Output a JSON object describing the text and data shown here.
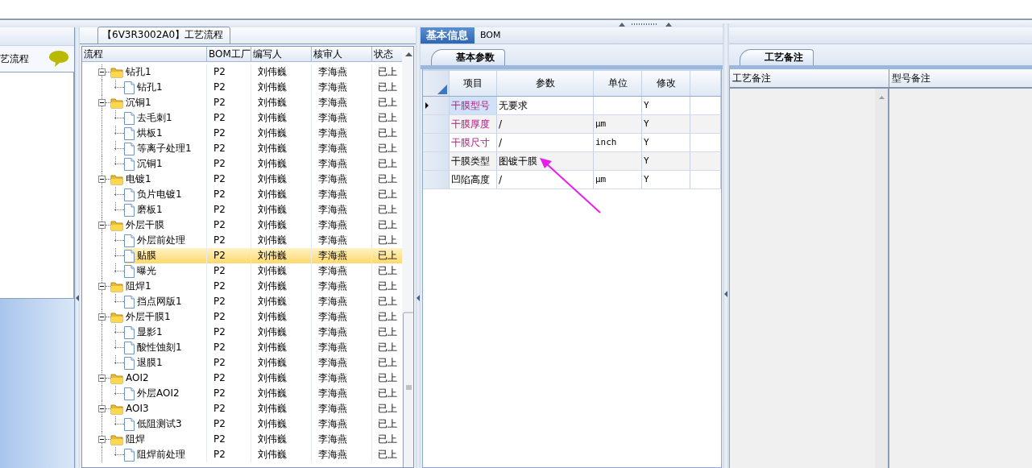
{
  "left_panel": {
    "title": "艺流程"
  },
  "process_tab": {
    "title": "【6V3R3002A0】工艺流程"
  },
  "process_table": {
    "columns": [
      "流程",
      "BOM工厂",
      "编写人",
      "核审人",
      "状态"
    ],
    "rows": [
      {
        "kind": "folder",
        "label": "钻孔1",
        "expanded": true,
        "selected": false,
        "bom": "P2",
        "author": "刘伟巍",
        "reviewer": "李海燕",
        "status": "已上",
        "children": [
          {
            "kind": "file",
            "label": "钻孔1",
            "selected": false,
            "bom": "P2",
            "author": "刘伟巍",
            "reviewer": "李海燕",
            "status": "已上"
          }
        ]
      },
      {
        "kind": "folder",
        "label": "沉铜1",
        "expanded": true,
        "selected": false,
        "bom": "P2",
        "author": "刘伟巍",
        "reviewer": "李海燕",
        "status": "已上",
        "children": [
          {
            "kind": "file",
            "label": "去毛刺1",
            "selected": false,
            "bom": "P2",
            "author": "刘伟巍",
            "reviewer": "李海燕",
            "status": "已上"
          },
          {
            "kind": "file",
            "label": "烘板1",
            "selected": false,
            "bom": "P2",
            "author": "刘伟巍",
            "reviewer": "李海燕",
            "status": "已上"
          },
          {
            "kind": "file",
            "label": "等离子处理1",
            "selected": false,
            "bom": "P2",
            "author": "刘伟巍",
            "reviewer": "李海燕",
            "status": "已上"
          },
          {
            "kind": "file",
            "label": "沉铜1",
            "selected": false,
            "bom": "P2",
            "author": "刘伟巍",
            "reviewer": "李海燕",
            "status": "已上"
          }
        ]
      },
      {
        "kind": "folder",
        "label": "电镀1",
        "expanded": true,
        "selected": false,
        "bom": "P2",
        "author": "刘伟巍",
        "reviewer": "李海燕",
        "status": "已上",
        "children": [
          {
            "kind": "file",
            "label": "负片电镀1",
            "selected": false,
            "bom": "P2",
            "author": "刘伟巍",
            "reviewer": "李海燕",
            "status": "已上"
          },
          {
            "kind": "file",
            "label": "磨板1",
            "selected": false,
            "bom": "P2",
            "author": "刘伟巍",
            "reviewer": "李海燕",
            "status": "已上"
          }
        ]
      },
      {
        "kind": "folder",
        "label": "外层干膜",
        "expanded": true,
        "selected": false,
        "bom": "P2",
        "author": "刘伟巍",
        "reviewer": "李海燕",
        "status": "已上",
        "children": [
          {
            "kind": "file",
            "label": "外层前处理",
            "selected": false,
            "bom": "P2",
            "author": "刘伟巍",
            "reviewer": "李海燕",
            "status": "已上"
          },
          {
            "kind": "file",
            "label": "贴膜",
            "selected": true,
            "bom": "P2",
            "author": "刘伟巍",
            "reviewer": "李海燕",
            "status": "已上"
          },
          {
            "kind": "file",
            "label": "曝光",
            "selected": false,
            "bom": "P2",
            "author": "刘伟巍",
            "reviewer": "李海燕",
            "status": "已上"
          }
        ]
      },
      {
        "kind": "folder",
        "label": "阻焊1",
        "expanded": true,
        "selected": false,
        "bom": "P2",
        "author": "刘伟巍",
        "reviewer": "李海燕",
        "status": "已上",
        "children": [
          {
            "kind": "file",
            "label": "挡点网版1",
            "selected": false,
            "bom": "P2",
            "author": "刘伟巍",
            "reviewer": "李海燕",
            "status": "已上"
          }
        ]
      },
      {
        "kind": "folder",
        "label": "外层干膜1",
        "expanded": true,
        "selected": false,
        "bom": "P2",
        "author": "刘伟巍",
        "reviewer": "李海燕",
        "status": "已上",
        "children": [
          {
            "kind": "file",
            "label": "显影1",
            "selected": false,
            "bom": "P2",
            "author": "刘伟巍",
            "reviewer": "李海燕",
            "status": "已上"
          },
          {
            "kind": "file",
            "label": "酸性蚀刻1",
            "selected": false,
            "bom": "P2",
            "author": "刘伟巍",
            "reviewer": "李海燕",
            "status": "已上"
          },
          {
            "kind": "file",
            "label": "退膜1",
            "selected": false,
            "bom": "P2",
            "author": "刘伟巍",
            "reviewer": "李海燕",
            "status": "已上"
          }
        ]
      },
      {
        "kind": "folder",
        "label": "AOI2",
        "expanded": true,
        "selected": false,
        "bom": "P2",
        "author": "刘伟巍",
        "reviewer": "李海燕",
        "status": "已上",
        "children": [
          {
            "kind": "file",
            "label": "外层AOI2",
            "selected": false,
            "bom": "P2",
            "author": "刘伟巍",
            "reviewer": "李海燕",
            "status": "已上"
          }
        ]
      },
      {
        "kind": "folder",
        "label": "AOI3",
        "expanded": true,
        "selected": false,
        "bom": "P2",
        "author": "刘伟巍",
        "reviewer": "李海燕",
        "status": "已上",
        "children": [
          {
            "kind": "file",
            "label": "低阻测试3",
            "selected": false,
            "bom": "P2",
            "author": "刘伟巍",
            "reviewer": "李海燕",
            "status": "已上"
          }
        ]
      },
      {
        "kind": "folder",
        "label": "阻焊",
        "expanded": true,
        "selected": false,
        "bom": "P2",
        "author": "刘伟巍",
        "reviewer": "李海燕",
        "status": "已上",
        "children": [
          {
            "kind": "file",
            "label": "阻焊前处理",
            "selected": false,
            "bom": "P2",
            "author": "刘伟巍",
            "reviewer": "李海燕",
            "status": "已上"
          }
        ]
      }
    ]
  },
  "detail_tabs": [
    {
      "label": "基本信息",
      "selected": true
    },
    {
      "label": "BOM",
      "selected": false
    }
  ],
  "param_panel": {
    "tab": "基本参数",
    "columns": [
      "项目",
      "参数",
      "单位",
      "修改"
    ],
    "rows": [
      {
        "item": "干膜型号",
        "value": "无要求",
        "modified": "Y",
        "highlighted": true,
        "selected": true
      },
      {
        "item": "干膜厚度",
        "value": "/",
        "unit": "μm",
        "modified": "Y",
        "highlighted": true,
        "selected": false
      },
      {
        "item": "干膜尺寸",
        "value": "/",
        "unit": "inch",
        "modified": "Y",
        "highlighted": true,
        "selected": false
      },
      {
        "item": "干膜类型",
        "value": "图镀干膜",
        "modified": "Y",
        "highlighted": false,
        "selected": false
      },
      {
        "item": "凹陷高度",
        "value": "/",
        "unit": "μm",
        "modified": "Y",
        "highlighted": false,
        "selected": false
      }
    ]
  },
  "remarks_panel": {
    "tab": "工艺备注",
    "columns": [
      "工艺备注",
      "型号备注"
    ]
  }
}
